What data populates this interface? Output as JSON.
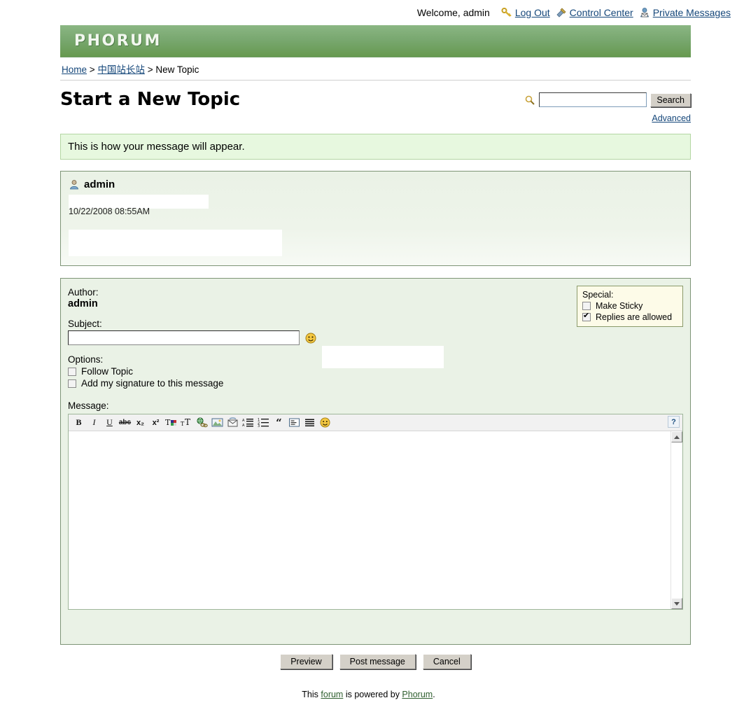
{
  "userbar": {
    "welcome": "Welcome, admin",
    "links": [
      {
        "label": "Log Out",
        "icon": "key-icon"
      },
      {
        "label": "Control Center",
        "icon": "tools-icon"
      },
      {
        "label": "Private Messages",
        "icon": "mail-person-icon"
      }
    ]
  },
  "banner": {
    "logo": "PHORUM"
  },
  "breadcrumb": {
    "home": "Home",
    "sep1": ">",
    "forum": "中国站长站",
    "sep2": ">",
    "current": "New Topic"
  },
  "page": {
    "title": "Start a New Topic"
  },
  "search": {
    "value": "",
    "placeholder": "",
    "button": "Search",
    "advanced": "Advanced",
    "icon": "magnifier-icon"
  },
  "notice": {
    "text": "This is how your message will appear."
  },
  "preview": {
    "author": "admin",
    "author_icon": "user-icon",
    "date": "10/22/2008 08:55AM"
  },
  "form": {
    "author_label": "Author:",
    "author_value": "admin",
    "subject_label": "Subject:",
    "subject_value": "",
    "smiley_icon": "smiley-icon",
    "options_label": "Options:",
    "options": [
      {
        "label": "Follow Topic",
        "checked": false
      },
      {
        "label": "Add my signature to this message",
        "checked": false
      }
    ],
    "special_label": "Special:",
    "special": [
      {
        "label": "Make Sticky",
        "checked": false
      },
      {
        "label": "Replies are allowed",
        "checked": true
      }
    ],
    "message_label": "Message:",
    "message_value": ""
  },
  "toolbar": {
    "help_label": "?",
    "buttons": [
      {
        "name": "bold-icon",
        "glyph": "B",
        "style": "b"
      },
      {
        "name": "italic-icon",
        "glyph": "I",
        "style": "i"
      },
      {
        "name": "underline-icon",
        "glyph": "U",
        "style": "u"
      },
      {
        "name": "strikethrough-icon",
        "glyph": "abc",
        "style": "s"
      },
      {
        "name": "subscript-icon",
        "glyph": "x₂",
        "style": "p"
      },
      {
        "name": "superscript-icon",
        "glyph": "x²",
        "style": "p"
      },
      {
        "name": "text-color-icon",
        "glyph": "T",
        "style": "color"
      },
      {
        "name": "font-size-icon",
        "glyph": "тT",
        "style": "size"
      },
      {
        "name": "insert-link-icon",
        "glyph": "🌐",
        "style": "img"
      },
      {
        "name": "insert-image-icon",
        "glyph": "🖼",
        "style": "img"
      },
      {
        "name": "insert-email-icon",
        "glyph": "✉",
        "style": "img"
      },
      {
        "name": "bullet-list-icon",
        "glyph": "≡",
        "style": "img"
      },
      {
        "name": "numbered-list-icon",
        "glyph": "≡",
        "style": "img"
      },
      {
        "name": "quote-icon",
        "glyph": "“",
        "style": "quote"
      },
      {
        "name": "code-block-icon",
        "glyph": "▤",
        "style": "img"
      },
      {
        "name": "align-icon",
        "glyph": "≣",
        "style": "img"
      },
      {
        "name": "smiley-icon",
        "glyph": "☺",
        "style": "smiley"
      }
    ]
  },
  "actions": {
    "preview": "Preview",
    "post": "Post message",
    "cancel": "Cancel"
  },
  "footer": {
    "pre": "This ",
    "forum_link": "forum",
    "mid": " is powered by ",
    "phorum_link": "Phorum",
    "post": "."
  },
  "colors": {
    "banner_green": "#79a870",
    "notice_bg": "#e7f8df",
    "panel_bg": "#eaf2e6",
    "special_bg": "#fdfbe8",
    "link": "#15477a"
  }
}
